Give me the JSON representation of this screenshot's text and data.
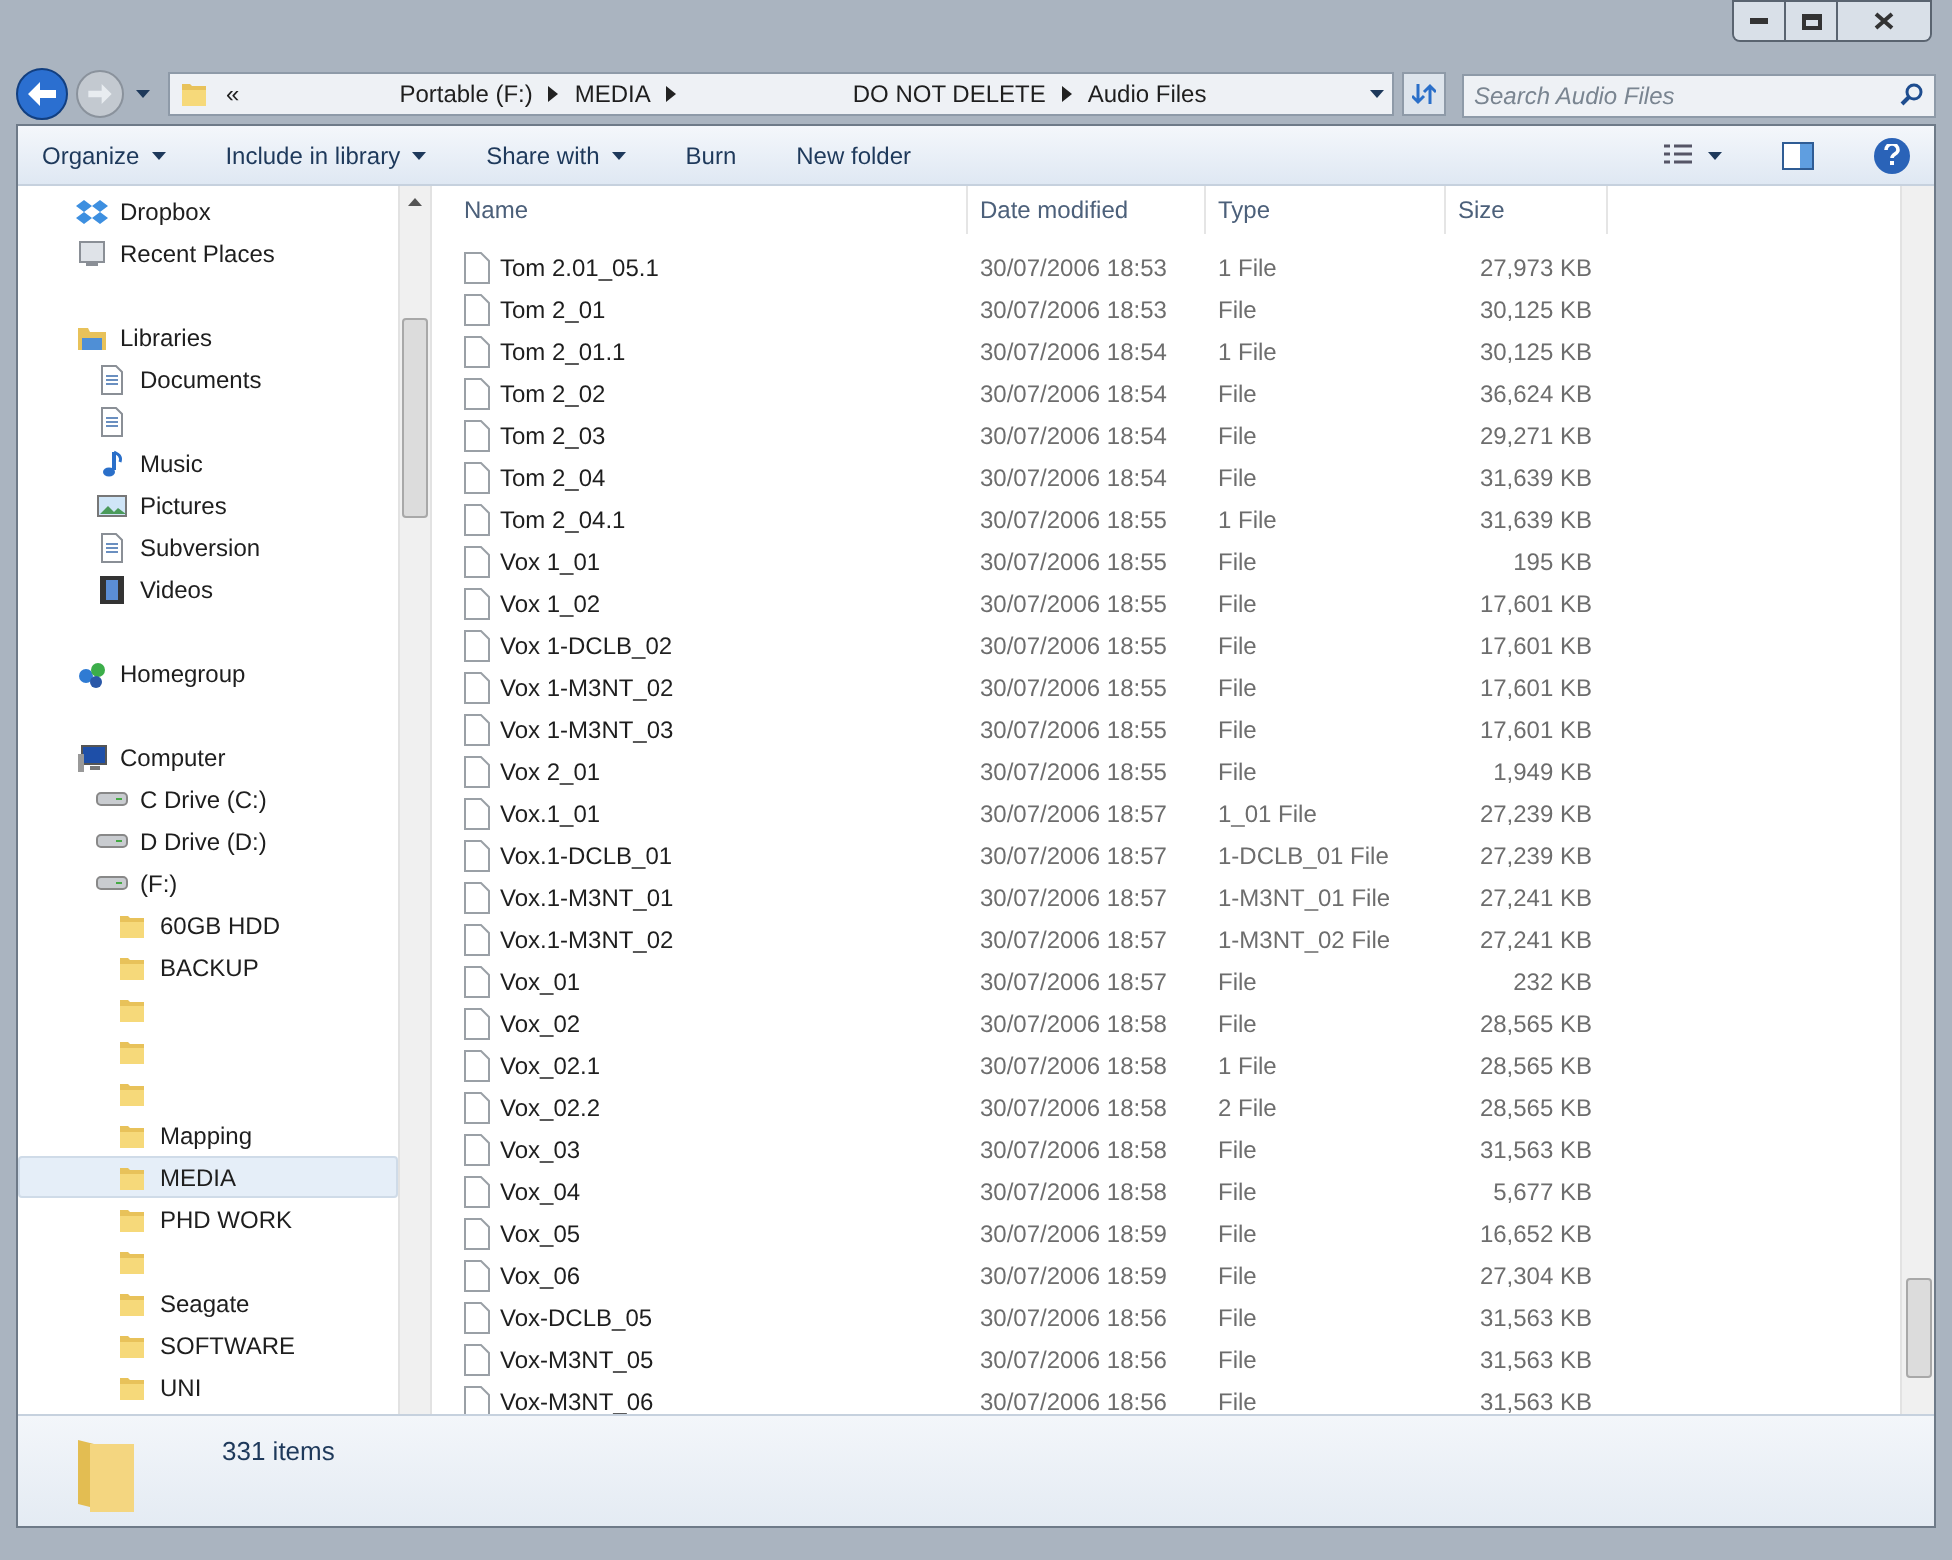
{
  "address_bar": {
    "overflow": "«",
    "crumbs": [
      "Portable (F:)",
      "MEDIA",
      "DO NOT DELETE",
      "Audio Files"
    ]
  },
  "search": {
    "placeholder": "Search Audio Files"
  },
  "toolbar": {
    "items": [
      {
        "label": "Organize",
        "dropdown": true
      },
      {
        "label": "Include in library",
        "dropdown": true
      },
      {
        "label": "Share with",
        "dropdown": true
      },
      {
        "label": "Burn",
        "dropdown": false
      },
      {
        "label": "New folder",
        "dropdown": false
      }
    ]
  },
  "sidebar": {
    "groups": [
      {
        "items": [
          {
            "label": "Dropbox",
            "kind": "dropbox",
            "selected": false
          },
          {
            "label": "Recent Places",
            "kind": "recent",
            "selected": false
          }
        ]
      },
      {
        "items": [
          {
            "label": "Libraries",
            "kind": "library",
            "selected": false,
            "children": [
              {
                "label": "Documents",
                "kind": "document",
                "selected": false
              },
              {
                "kind": "document",
                "selected": false
              },
              {
                "label": "Music",
                "kind": "music",
                "selected": false
              },
              {
                "label": "Pictures",
                "kind": "picture",
                "selected": false
              },
              {
                "label": "Subversion",
                "kind": "document",
                "selected": false
              },
              {
                "label": "Videos",
                "kind": "video",
                "selected": false
              }
            ]
          }
        ]
      },
      {
        "items": [
          {
            "label": "Homegroup",
            "kind": "homegroup",
            "selected": false
          }
        ]
      },
      {
        "items": [
          {
            "label": "Computer",
            "kind": "computer",
            "selected": false,
            "children": [
              {
                "label": "C Drive (C:)",
                "kind": "drive",
                "selected": false
              },
              {
                "label": "D Drive (D:)",
                "kind": "drive",
                "selected": false
              },
              {
                "label": "(F:)",
                "kind": "drive",
                "selected": false,
                "children": [
                  {
                    "label": "60GB HDD",
                    "kind": "folder",
                    "selected": false
                  },
                  {
                    "label": "BACKUP",
                    "kind": "folder",
                    "selected": false
                  },
                  {
                    "kind": "folder",
                    "selected": false
                  },
                  {
                    "kind": "folder",
                    "selected": false
                  },
                  {
                    "kind": "folder",
                    "selected": false
                  },
                  {
                    "label": "Mapping",
                    "kind": "folder",
                    "selected": false
                  },
                  {
                    "label": "MEDIA",
                    "kind": "folder",
                    "selected": true
                  },
                  {
                    "label": "PHD WORK",
                    "kind": "folder",
                    "selected": false
                  },
                  {
                    "kind": "folder",
                    "selected": false
                  },
                  {
                    "label": "Seagate",
                    "kind": "folder",
                    "selected": false
                  },
                  {
                    "label": "SOFTWARE",
                    "kind": "folder",
                    "selected": false
                  },
                  {
                    "label": "UNI",
                    "kind": "folder",
                    "selected": false
                  }
                ]
              }
            ]
          }
        ]
      }
    ]
  },
  "table": {
    "columns": [
      "Name",
      "Date modified",
      "Type",
      "Size"
    ],
    "rows": [
      [
        "Tom 2.01_05.1",
        "30/07/2006 18:53",
        "1 File",
        "27,973 KB"
      ],
      [
        "Tom 2_01",
        "30/07/2006 18:53",
        "File",
        "30,125 KB"
      ],
      [
        "Tom 2_01.1",
        "30/07/2006 18:54",
        "1 File",
        "30,125 KB"
      ],
      [
        "Tom 2_02",
        "30/07/2006 18:54",
        "File",
        "36,624 KB"
      ],
      [
        "Tom 2_03",
        "30/07/2006 18:54",
        "File",
        "29,271 KB"
      ],
      [
        "Tom 2_04",
        "30/07/2006 18:54",
        "File",
        "31,639 KB"
      ],
      [
        "Tom 2_04.1",
        "30/07/2006 18:55",
        "1 File",
        "31,639 KB"
      ],
      [
        "Vox 1_01",
        "30/07/2006 18:55",
        "File",
        "195 KB"
      ],
      [
        "Vox 1_02",
        "30/07/2006 18:55",
        "File",
        "17,601 KB"
      ],
      [
        "Vox 1-DCLB_02",
        "30/07/2006 18:55",
        "File",
        "17,601 KB"
      ],
      [
        "Vox 1-M3NT_02",
        "30/07/2006 18:55",
        "File",
        "17,601 KB"
      ],
      [
        "Vox 1-M3NT_03",
        "30/07/2006 18:55",
        "File",
        "17,601 KB"
      ],
      [
        "Vox 2_01",
        "30/07/2006 18:55",
        "File",
        "1,949 KB"
      ],
      [
        "Vox.1_01",
        "30/07/2006 18:57",
        "1_01 File",
        "27,239 KB"
      ],
      [
        "Vox.1-DCLB_01",
        "30/07/2006 18:57",
        "1-DCLB_01 File",
        "27,239 KB"
      ],
      [
        "Vox.1-M3NT_01",
        "30/07/2006 18:57",
        "1-M3NT_01 File",
        "27,241 KB"
      ],
      [
        "Vox.1-M3NT_02",
        "30/07/2006 18:57",
        "1-M3NT_02 File",
        "27,241 KB"
      ],
      [
        "Vox_01",
        "30/07/2006 18:57",
        "File",
        "232 KB"
      ],
      [
        "Vox_02",
        "30/07/2006 18:58",
        "File",
        "28,565 KB"
      ],
      [
        "Vox_02.1",
        "30/07/2006 18:58",
        "1 File",
        "28,565 KB"
      ],
      [
        "Vox_02.2",
        "30/07/2006 18:58",
        "2 File",
        "28,565 KB"
      ],
      [
        "Vox_03",
        "30/07/2006 18:58",
        "File",
        "31,563 KB"
      ],
      [
        "Vox_04",
        "30/07/2006 18:58",
        "File",
        "5,677 KB"
      ],
      [
        "Vox_05",
        "30/07/2006 18:59",
        "File",
        "16,652 KB"
      ],
      [
        "Vox_06",
        "30/07/2006 18:59",
        "File",
        "27,304 KB"
      ],
      [
        "Vox-DCLB_05",
        "30/07/2006 18:56",
        "File",
        "31,563 KB"
      ],
      [
        "Vox-M3NT_05",
        "30/07/2006 18:56",
        "File",
        "31,563 KB"
      ],
      [
        "Vox-M3NT_06",
        "30/07/2006 18:56",
        "File",
        "31,563 KB"
      ]
    ]
  },
  "status_bar": {
    "count": "331 items"
  }
}
